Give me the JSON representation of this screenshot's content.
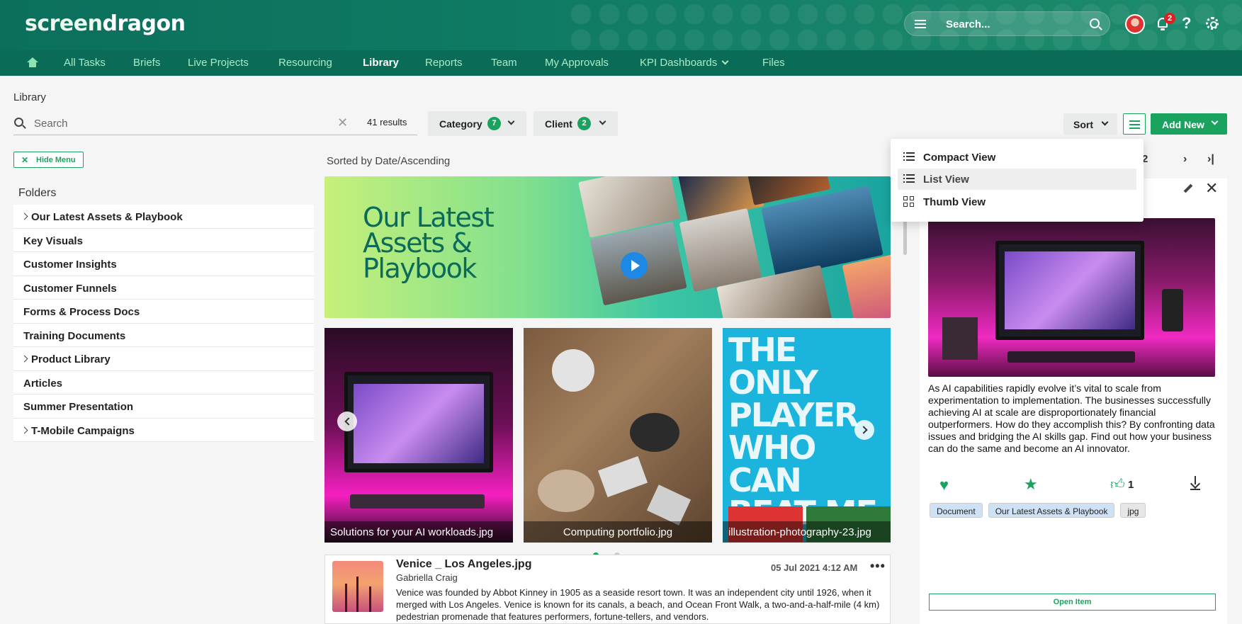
{
  "app": {
    "logo_a": "screen",
    "logo_b": "dragon",
    "search_placeholder": "Search...",
    "notifications_count": "2",
    "help_label": "?"
  },
  "nav": {
    "items": [
      "All Tasks",
      "Briefs",
      "Live Projects",
      "Resourcing",
      "Library",
      "Reports",
      "Team",
      "My Approvals",
      "KPI Dashboards",
      "Files"
    ],
    "active": "Library"
  },
  "library": {
    "title": "Library",
    "search_placeholder": "Search",
    "results": "41 results",
    "filters": [
      {
        "label": "Category",
        "count": "7"
      },
      {
        "label": "Client",
        "count": "2"
      }
    ],
    "sort_label": "Sort",
    "add_new_label": "Add New",
    "sorted_by": "Sorted by Date/Ascending"
  },
  "sidebar": {
    "hide_menu_label": "Hide Menu",
    "folders_title": "Folders",
    "folders": [
      {
        "name": "Our Latest Assets & Playbook",
        "expandable": true
      },
      {
        "name": "Key Visuals",
        "expandable": false
      },
      {
        "name": "Customer Insights",
        "expandable": false
      },
      {
        "name": "Customer Funnels",
        "expandable": false
      },
      {
        "name": "Forms & Process Docs",
        "expandable": false
      },
      {
        "name": "Training Documents",
        "expandable": false
      },
      {
        "name": "Product Library",
        "expandable": true
      },
      {
        "name": "Articles",
        "expandable": false
      },
      {
        "name": "Summer Presentation",
        "expandable": false
      },
      {
        "name": "T-Mobile Campaigns",
        "expandable": true
      }
    ]
  },
  "banner": {
    "title": "Our Latest Assets & Playbook"
  },
  "thumbs": [
    {
      "caption": "Solutions for your AI workloads.jpg"
    },
    {
      "caption": "Computing portfolio.jpg"
    },
    {
      "caption": "illustration-photography-23.jpg"
    }
  ],
  "thumb3_text": "THE ONLY PLAYER WHO CAN BEAT ME",
  "list_item": {
    "name": "Venice _ Los Angeles.jpg",
    "author": "Gabriella Craig",
    "date": "05 Jul 2021 4:12 AM",
    "more": "•••",
    "description": "Venice was founded by Abbot Kinney in 1905 as a seaside resort town. It was an independent city until 1926, when it merged with Los Angeles. Venice is known for its canals, a beach, and Ocean Front Walk, a two-and-a-half-mile (4 km) pedestrian promenade that features performers, fortune-tellers, and vendors."
  },
  "pager": {
    "next_page": "2"
  },
  "view_menu": {
    "items": [
      "Compact View",
      "List View",
      "Thumb View"
    ],
    "hovered": "List View"
  },
  "detail": {
    "description": "As AI capabilities rapidly evolve it’s vital to scale from experimentation to implementation. The businesses successfully achieving AI at scale are disproportionately financial outperformers. How do they accomplish this? By confronting data issues and bridging the AI skills gap. Find out how your business can do the same and become an AI innovator.",
    "likes": "1",
    "tags": [
      {
        "label": "Document",
        "color": "#cfe2f5"
      },
      {
        "label": "Our Latest Assets & Playbook",
        "color": "#cfe2f5"
      },
      {
        "label": "jpg",
        "color": "#e6e6e6"
      }
    ],
    "open_item_label": "Open Item"
  },
  "colors": {
    "brand": "#0b6f5b",
    "accent": "#1aa35e",
    "badge": "#e02020"
  }
}
